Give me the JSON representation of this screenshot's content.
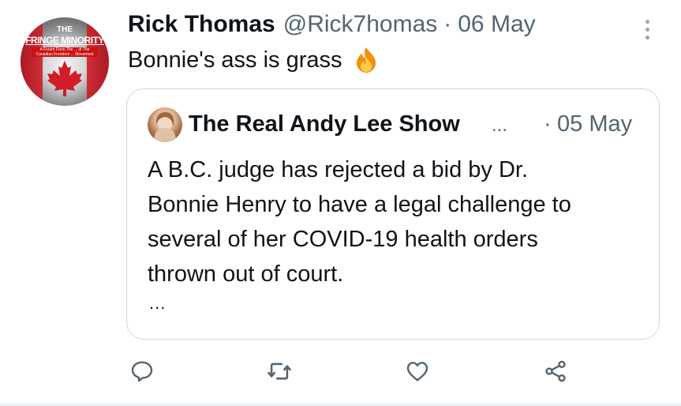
{
  "tweet": {
    "author_name": "Rick Thomas",
    "author_handle": "@Rick7homas",
    "separator": "·",
    "date": "06 May",
    "text": "Bonnie's ass is grass",
    "emoji_icon": "fire-icon",
    "avatar": {
      "line1": "THE",
      "line2": "FRINGE MINORITY",
      "line3": "A Forum From The ... of The Canadian Freedom ... Movement"
    }
  },
  "quoted_tweet": {
    "author_name": "The Real Andy Lee Show",
    "name_truncation": "...",
    "separator": "·",
    "date": "05 May",
    "lines": [
      "A B.C. judge has rejected a bid by Dr.",
      "Bonnie Henry to have a legal challenge to",
      "several of her COVID-19 health orders",
      "thrown out of court."
    ],
    "more": "..."
  },
  "actions": [
    {
      "name": "reply",
      "icon": "reply-icon"
    },
    {
      "name": "retweet",
      "icon": "retweet-icon"
    },
    {
      "name": "like",
      "icon": "heart-icon"
    },
    {
      "name": "share",
      "icon": "share-icon"
    }
  ],
  "colors": {
    "text": "#0f1419",
    "secondary": "#536471",
    "border": "#cfd9de",
    "flag_red": "#d11d27"
  }
}
